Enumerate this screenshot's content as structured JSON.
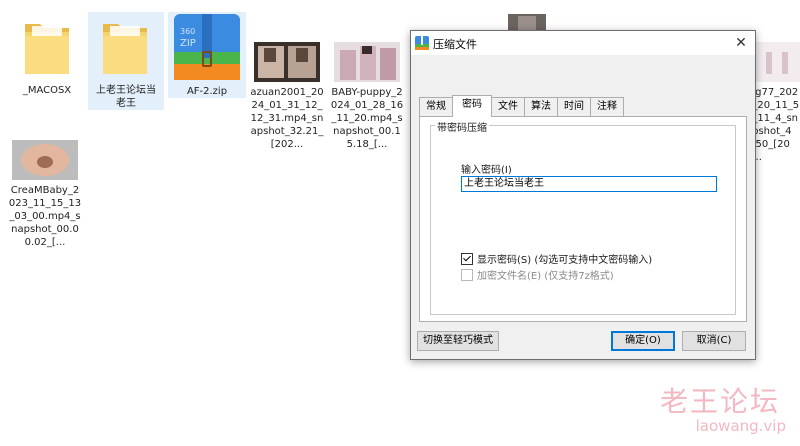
{
  "files": [
    {
      "label": "_MACOSX"
    },
    {
      "label": "上老王论坛当老王"
    },
    {
      "label": "AF-2.zip"
    },
    {
      "label": "azuan2001_2024_01_31_12_12_31.mp4_snapshot_32.21_[202..."
    },
    {
      "label": "BABY-puppy_2024_01_28_16_11_20.mp4_snapshot_00.15.18_[..."
    },
    {
      "label": "ing77_2024_20_11_58_11_4_snapshot_42.50_[202..."
    },
    {
      "label": "CreaMBaby_2023_11_15_13_03_00.mp4_snapshot_00.00.02_[..."
    }
  ],
  "zip_badge": {
    "line1": "360",
    "line2": "ZIP"
  },
  "dialog": {
    "title": "压缩文件",
    "tabs": [
      "常规",
      "密码",
      "文件",
      "算法",
      "时间",
      "注释"
    ],
    "group_title": "带密码压缩",
    "password_label": "输入密码(I)",
    "password_value": "上老王论坛当老王",
    "show_password_label": "显示密码(S)  (勾选可支持中文密码输入)",
    "encrypt_names_label": "加密文件名(E)  (仅支持7z格式)",
    "switch_mode_button": "切换至轻巧模式",
    "ok_button": "确定(O)",
    "cancel_button": "取消(C)"
  },
  "watermark": {
    "text": "老王论坛",
    "url": "laowang.vip"
  },
  "colors": {
    "folder": "#f6d36b",
    "zip_green": "#49b54a",
    "zip_orange": "#f28a21",
    "zip_blue": "#3b8be0",
    "watermark": "#f3b8c2"
  }
}
